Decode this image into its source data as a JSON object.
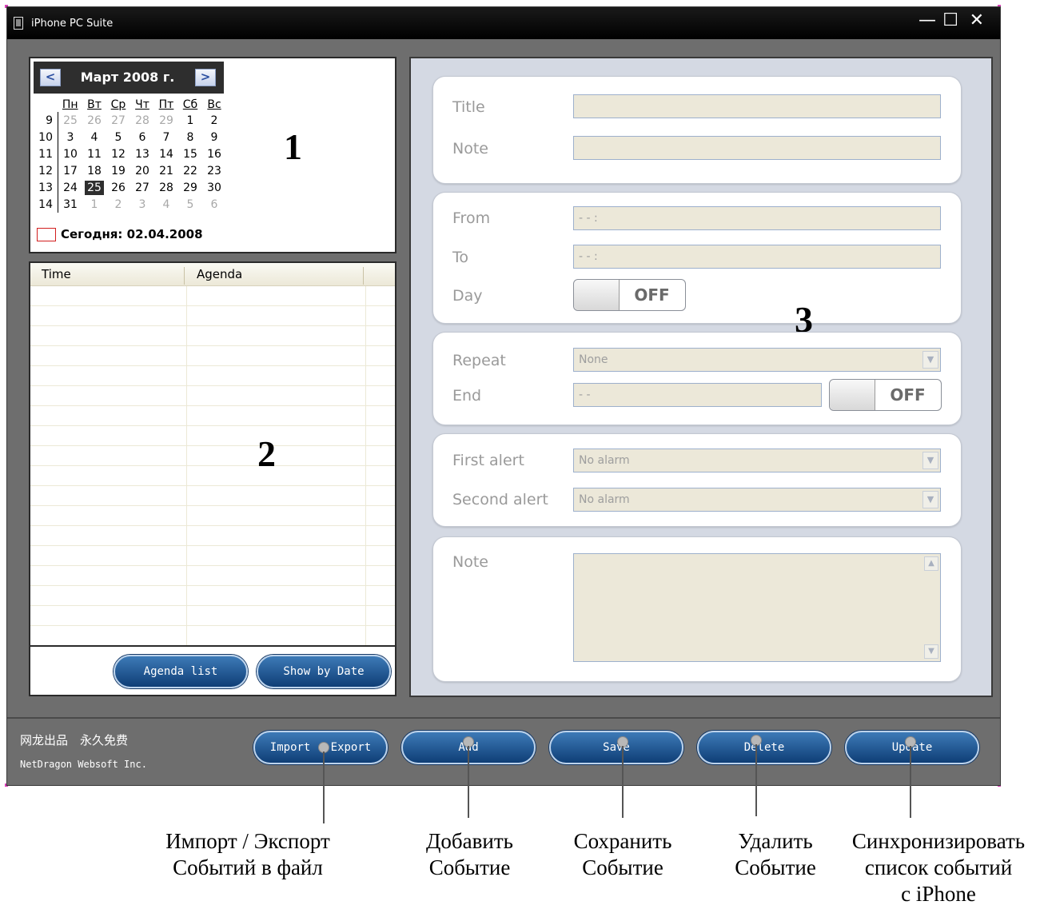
{
  "window": {
    "title": "iPhone PC Suite",
    "minimize": "—",
    "maximize": "☐",
    "close": "✕"
  },
  "calendar": {
    "month_label": "Март 2008 г.",
    "prev": "<",
    "next": ">",
    "weekdays": [
      "Пн",
      "Вт",
      "Ср",
      "Чт",
      "Пт",
      "Сб",
      "Вс"
    ],
    "weeks": [
      {
        "num": "9",
        "days": [
          "25",
          "26",
          "27",
          "28",
          "29",
          "1",
          "2"
        ]
      },
      {
        "num": "10",
        "days": [
          "3",
          "4",
          "5",
          "6",
          "7",
          "8",
          "9"
        ]
      },
      {
        "num": "11",
        "days": [
          "10",
          "11",
          "12",
          "13",
          "14",
          "15",
          "16"
        ]
      },
      {
        "num": "12",
        "days": [
          "17",
          "18",
          "19",
          "20",
          "21",
          "22",
          "23"
        ]
      },
      {
        "num": "13",
        "days": [
          "24",
          "25",
          "26",
          "27",
          "28",
          "29",
          "30"
        ]
      },
      {
        "num": "14",
        "days": [
          "31",
          "1",
          "2",
          "3",
          "4",
          "5",
          "6"
        ]
      }
    ],
    "selected_day": "25",
    "today_label": "Сегодня: 02.04.2008"
  },
  "annotations": {
    "n1": "1",
    "n2": "2",
    "n3": "3"
  },
  "agenda": {
    "columns": [
      "Time",
      "Agenda"
    ],
    "buttons": {
      "agenda_list": "Agenda list",
      "show_by_date": "Show by Date"
    }
  },
  "form": {
    "title_label": "Title",
    "note_label": "Note",
    "from_label": "From",
    "from_value": "- -   :",
    "to_label": "To",
    "to_value": "- -   :",
    "day_label": "Day",
    "day_toggle": "OFF",
    "repeat_label": "Repeat",
    "repeat_value": "None",
    "end_label": "End",
    "end_value": "- -",
    "end_toggle": "OFF",
    "first_alert_label": "First alert",
    "first_alert_value": "No alarm",
    "second_alert_label": "Second alert",
    "second_alert_value": "No alarm",
    "note2_label": "Note"
  },
  "footer": {
    "brand_cn": "网龙出品　永久免费",
    "brand_en": "NetDragon Websoft Inc.",
    "import_export": "Import · Export",
    "add": "Add",
    "save": "Save",
    "delete": "Delete",
    "update": "Update"
  },
  "callouts": {
    "import_export": [
      "Импорт / Экспорт",
      "Событий в файл"
    ],
    "add": [
      "Добавить",
      "Событие"
    ],
    "save": [
      "Сохранить",
      "Событие"
    ],
    "delete": [
      "Удалить",
      "Событие"
    ],
    "update": [
      "Синхронизировать",
      "список событий",
      "с iPhone"
    ]
  },
  "colors": {
    "accent": "#0f3e76",
    "window_bg": "#6e6e6e",
    "field_bg": "#ece8d9"
  }
}
